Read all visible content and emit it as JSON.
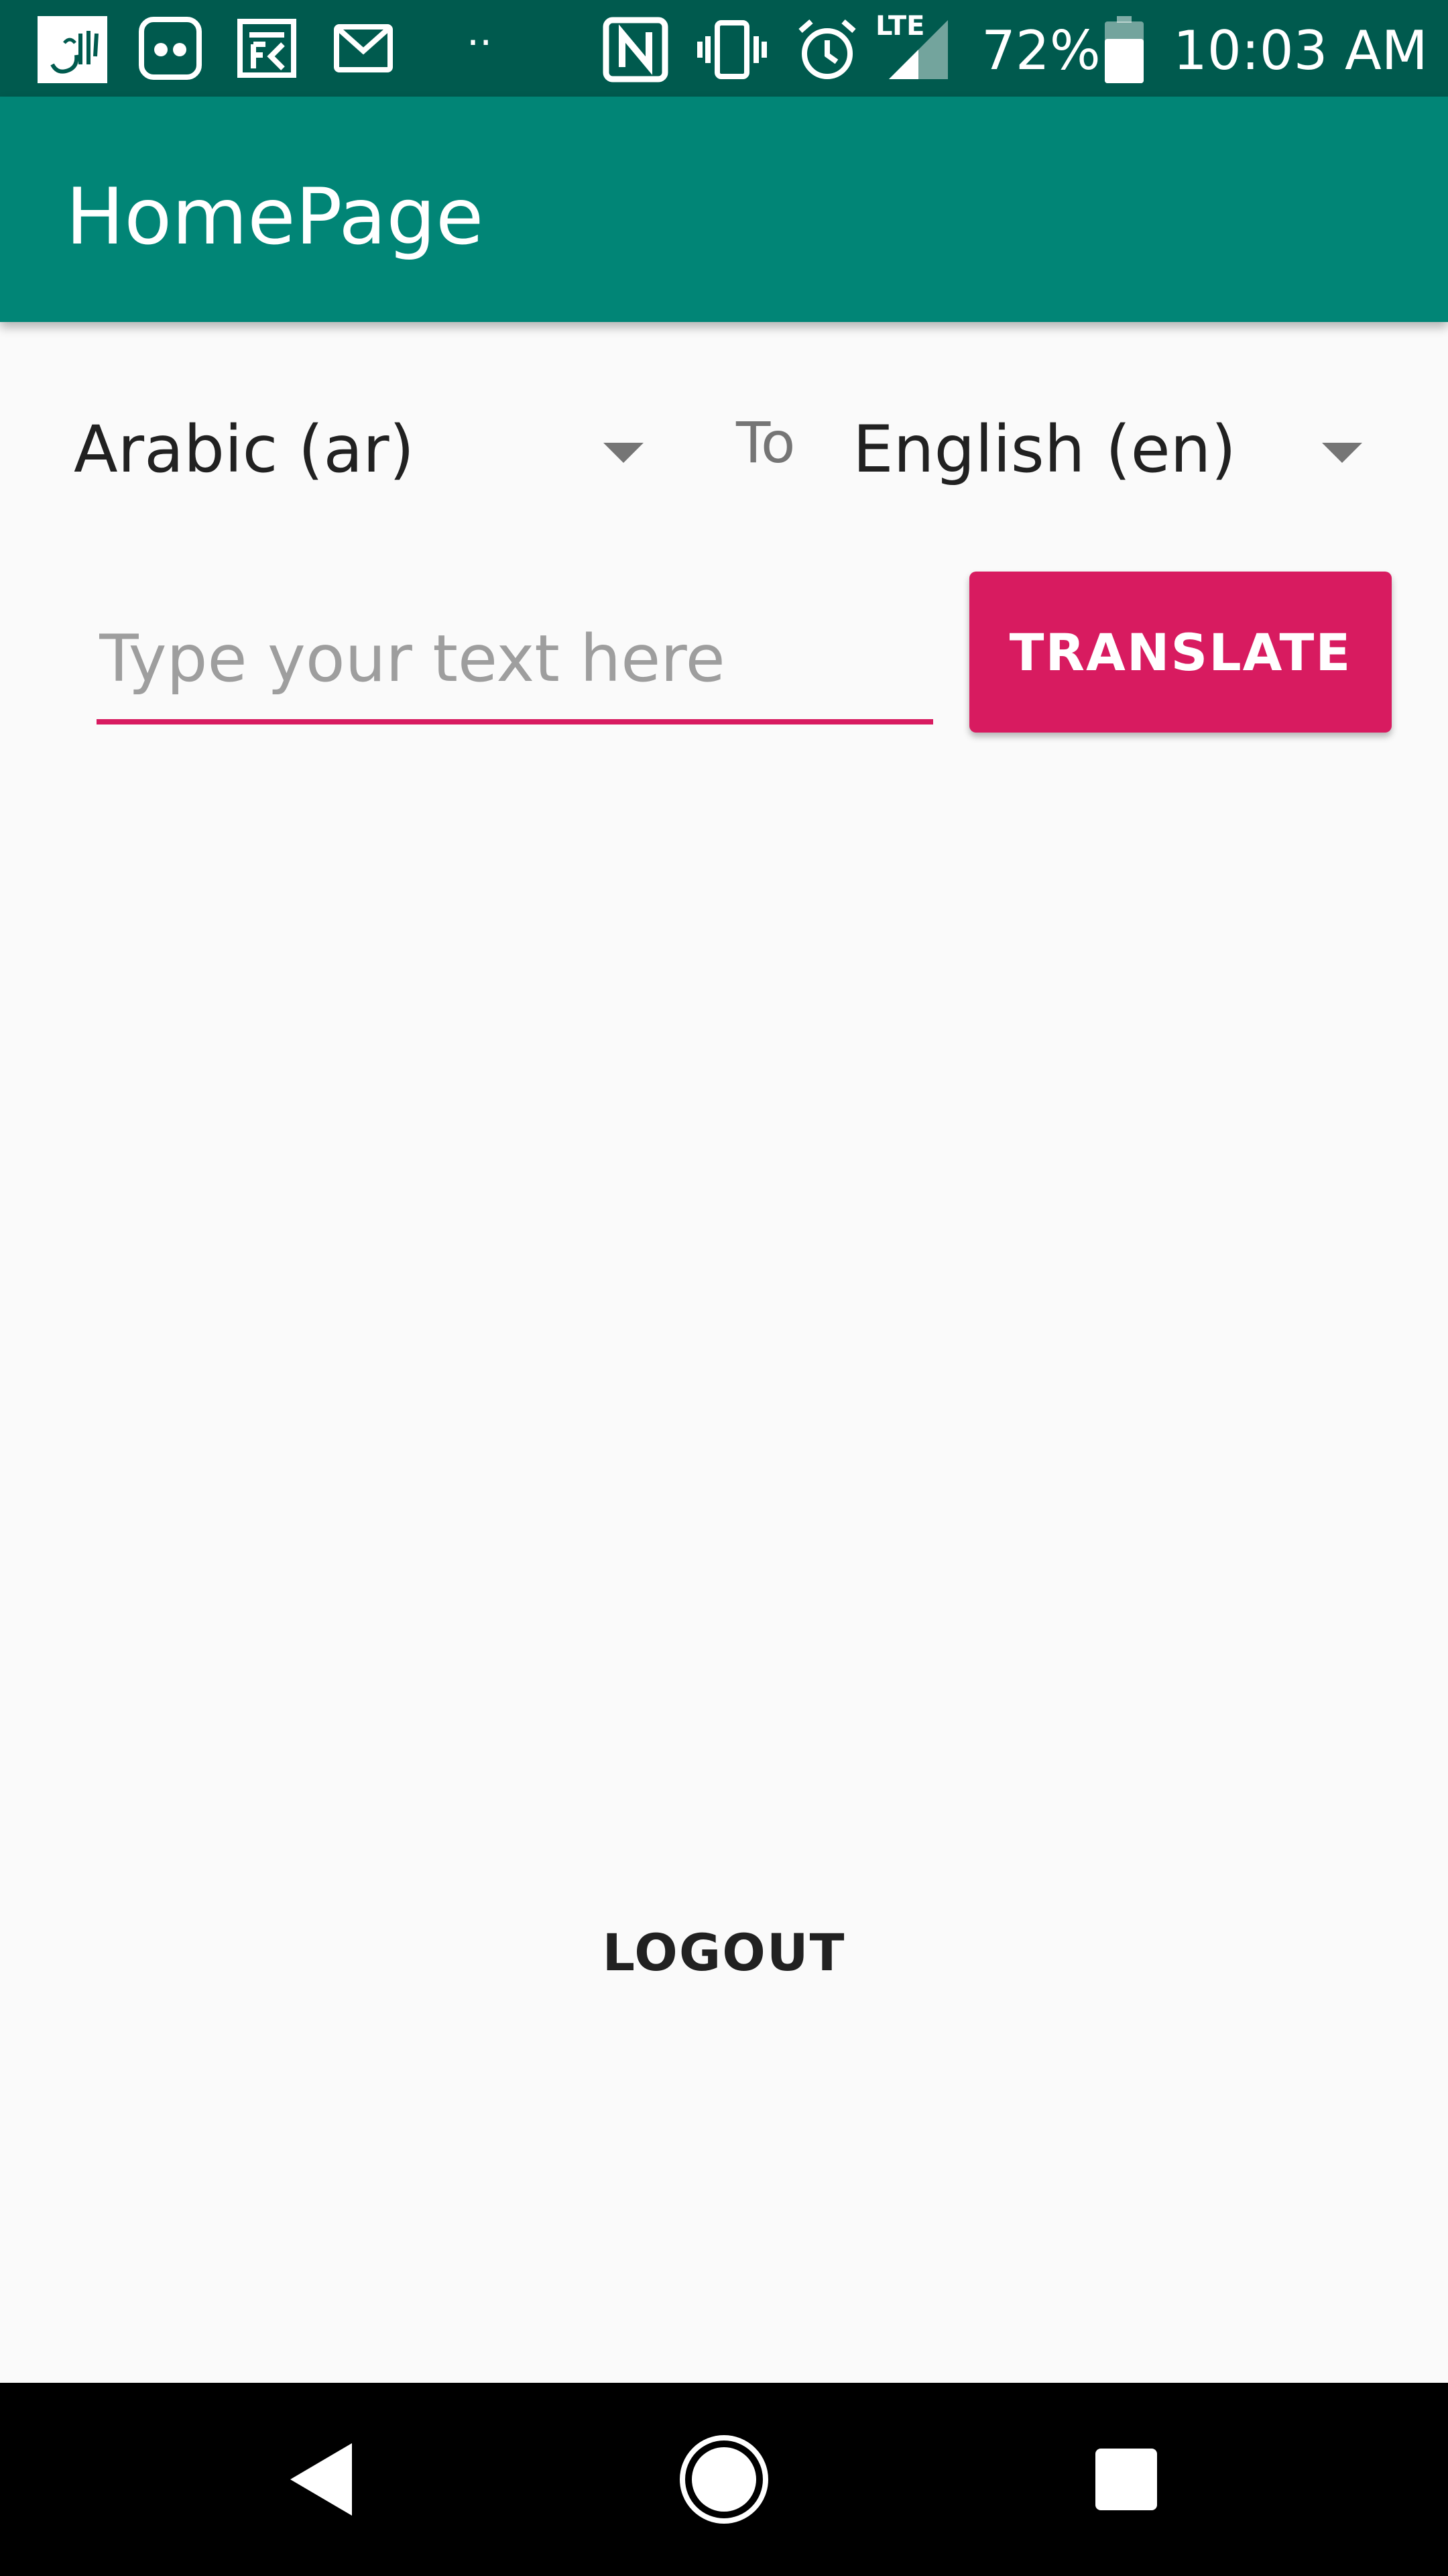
{
  "status_bar": {
    "time": "10:03 AM",
    "battery_percent": "72%",
    "network_type": "LTE",
    "more_notifications": "··",
    "notification_icons": [
      "arabic-app-icon",
      "messenger-app-icon",
      "news-app-icon",
      "gmail-icon"
    ],
    "system_icons": [
      "nfc-icon",
      "vibrate-icon",
      "alarm-icon",
      "signal-icon",
      "battery-icon"
    ]
  },
  "app_bar": {
    "title": "HomePage"
  },
  "translator": {
    "source_language": "Arabic (ar)",
    "to_label": "To",
    "target_language": "English (en)",
    "input_placeholder": "Type your text here",
    "input_value": "",
    "translate_label": "TRANSLATE"
  },
  "footer": {
    "logout_label": "LOGOUT"
  },
  "nav_bar": {
    "buttons": [
      "back-icon",
      "home-icon",
      "recents-icon"
    ]
  },
  "colors": {
    "status_bar": "#005a4e",
    "app_bar": "#018576",
    "accent": "#d81b60",
    "background": "#fafafa"
  }
}
